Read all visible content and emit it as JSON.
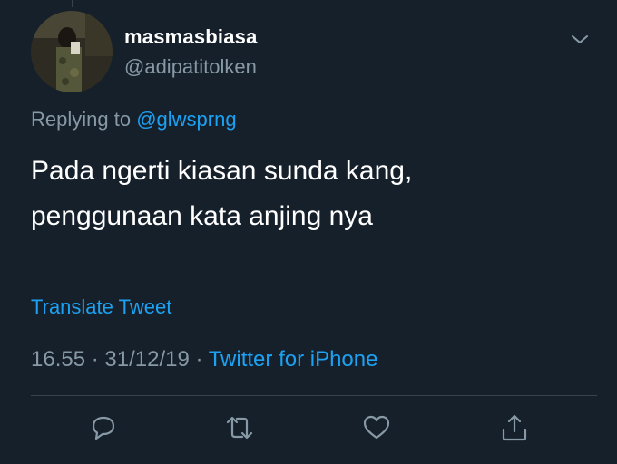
{
  "user": {
    "display_name": "masmasbiasa",
    "handle": "@adipatitolken"
  },
  "reply": {
    "prefix": "Replying to ",
    "mention": "@glwsprng"
  },
  "tweet": {
    "line1": "Pada ngerti kiasan sunda kang,",
    "line2": "penggunaan kata anjing nya"
  },
  "translate_label": "Translate Tweet",
  "meta": {
    "time": "16.55",
    "sep1": " · ",
    "date": "31/12/19",
    "sep2": " · ",
    "source": "Twitter for iPhone"
  },
  "icons": {
    "more": "chevron-down-icon",
    "reply": "reply-icon",
    "retweet": "retweet-icon",
    "like": "heart-icon",
    "share": "share-icon"
  },
  "colors": {
    "background": "#15202b",
    "accent": "#1da1f2",
    "secondary_text": "#8899a6",
    "divider": "#38444d"
  }
}
